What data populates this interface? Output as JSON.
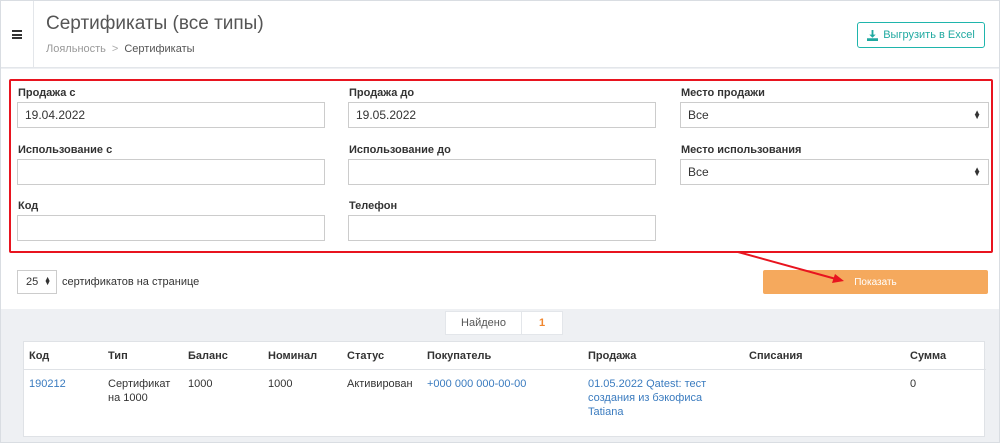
{
  "header": {
    "title": "Сертификаты (все типы)",
    "breadcrumb": {
      "parent": "Лояльность",
      "separator": ">",
      "current": "Сертификаты"
    },
    "export_label": "Выгрузить в Excel"
  },
  "filters": {
    "sale_from": {
      "label": "Продажа с",
      "value": "19.04.2022"
    },
    "sale_to": {
      "label": "Продажа до",
      "value": "19.05.2022"
    },
    "sale_place": {
      "label": "Место продажи",
      "value": "Все"
    },
    "use_from": {
      "label": "Использование с",
      "value": ""
    },
    "use_to": {
      "label": "Использование до",
      "value": ""
    },
    "use_place": {
      "label": "Место использования",
      "value": "Все"
    },
    "code": {
      "label": "Код",
      "value": ""
    },
    "phone": {
      "label": "Телефон",
      "value": ""
    }
  },
  "paging": {
    "per_page": "25",
    "per_page_label": "сертификатов на странице"
  },
  "show_label": "Показать",
  "found": {
    "label": "Найдено",
    "count": "1"
  },
  "table": {
    "columns": [
      "Код",
      "Тип",
      "Баланс",
      "Номинал",
      "Статус",
      "Покупатель",
      "Продажа",
      "Списания",
      "Сумма"
    ],
    "rows": [
      {
        "code": "190212",
        "type": "Сертификат на 1000",
        "balance": "1000",
        "nominal": "1000",
        "status": "Активирован",
        "buyer": "+000 000 000-00-00",
        "sale": "01.05.2022 Qatest: тест создания из бэкофиса Tatiana",
        "writeoffs": "",
        "sum": "0"
      }
    ]
  },
  "colors": {
    "accent": "#1fa9a0",
    "show_button": "#f5a95d",
    "highlight": "#e8141f",
    "link": "#3a7bbf"
  },
  "icons": {
    "menu": "hamburger-icon",
    "export": "download-icon",
    "select": "select-caret-icon"
  }
}
